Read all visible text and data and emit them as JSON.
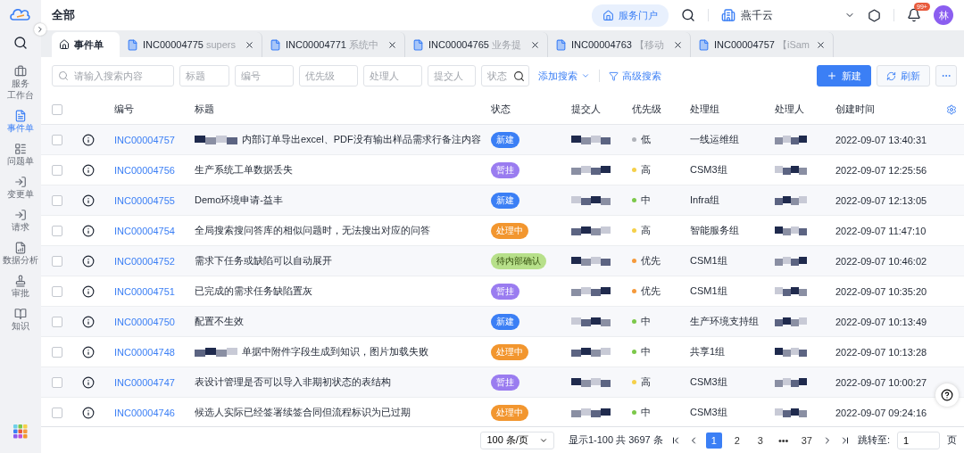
{
  "sidebar": {
    "items": [
      {
        "kind": "workbench",
        "lines": [
          "服务",
          "工作台"
        ],
        "selected": false
      },
      {
        "kind": "incident",
        "lines": [
          "事件单"
        ],
        "selected": true
      },
      {
        "kind": "problem",
        "lines": [
          "问题单"
        ],
        "selected": false
      },
      {
        "kind": "change",
        "lines": [
          "变更单"
        ],
        "selected": false
      },
      {
        "kind": "request",
        "lines": [
          "请求"
        ],
        "selected": false
      },
      {
        "kind": "analytics",
        "lines": [
          "数据分析"
        ],
        "selected": false
      },
      {
        "kind": "approval",
        "lines": [
          "审批"
        ],
        "selected": false
      },
      {
        "kind": "knowledge",
        "lines": [
          "知识"
        ],
        "selected": false
      }
    ]
  },
  "header": {
    "title": "全部",
    "portal": "服务门户",
    "org": "燕千云",
    "notifications": "99+",
    "avatar": "林"
  },
  "tabs": [
    {
      "kind": "home",
      "label": "事件单",
      "selected": true
    },
    {
      "kind": "ticket",
      "label": "INC00004775",
      "detail": "supers",
      "selected": false
    },
    {
      "kind": "ticket",
      "label": "INC00004771",
      "detail": "系统中",
      "selected": false
    },
    {
      "kind": "ticket",
      "label": "INC00004765",
      "detail": "业务提",
      "selected": false
    },
    {
      "kind": "ticket",
      "label": "INC00004763",
      "detail": "【移动",
      "selected": false
    },
    {
      "kind": "ticket",
      "label": "INC00004757",
      "detail": "【iSam",
      "selected": false
    }
  ],
  "filters": {
    "search": {
      "placeholder": "请输入搜索内容"
    },
    "fields": [
      {
        "placeholder": "标题"
      },
      {
        "placeholder": "编号"
      },
      {
        "placeholder": "优先级"
      },
      {
        "placeholder": "处理人"
      },
      {
        "placeholder": "提交人"
      },
      {
        "placeholder": "状态"
      }
    ],
    "add_search": "添加搜索",
    "advanced_search": "高级搜索",
    "new_button": "新建",
    "refresh_button": "刷新"
  },
  "table": {
    "select_all_checked": false,
    "columns": [
      "编号",
      "标题",
      "状态",
      "提交人",
      "优先级",
      "处理组",
      "处理人",
      "创建时间"
    ],
    "rows": [
      {
        "checked": false,
        "id": "INC00004757",
        "redacted": true,
        "title": "内部订单导出excel、PDF没有输出样品需求行备注内容",
        "status": {
          "label": "新建",
          "color": "#3b7ff5"
        },
        "priority": {
          "label": "低",
          "color": "#b0b3ba"
        },
        "group": "一线运维组",
        "created": "2022-09-07 13:40:31"
      },
      {
        "checked": false,
        "id": "INC00004756",
        "redacted": false,
        "title": "生产系统工单数据丢失",
        "status": {
          "label": "暂挂",
          "color": "#9a7cf0"
        },
        "priority": {
          "label": "高",
          "color": "#f5d04a"
        },
        "group": "CSM3组",
        "created": "2022-09-07 12:25:56"
      },
      {
        "checked": false,
        "id": "INC00004755",
        "redacted": false,
        "title": "Demo环境申请-益丰",
        "status": {
          "label": "新建",
          "color": "#3b7ff5"
        },
        "priority": {
          "label": "中",
          "color": "#7cc84a"
        },
        "group": "Infra组",
        "created": "2022-09-07 12:13:05"
      },
      {
        "checked": false,
        "id": "INC00004754",
        "redacted": false,
        "title": "全局搜索搜问答库的相似问题时，无法搜出对应的问答",
        "status": {
          "label": "处理中",
          "color": "#f2962f"
        },
        "priority": {
          "label": "高",
          "color": "#f5d04a"
        },
        "group": "智能服务组",
        "created": "2022-09-07 11:47:10"
      },
      {
        "checked": false,
        "id": "INC00004752",
        "redacted": false,
        "title": "需求下任务或缺陷可以自动展开",
        "status": {
          "label": "待内部确认",
          "color": "#b7e08a"
        },
        "priority": {
          "label": "优先",
          "color": "#f59a3c"
        },
        "group": "CSM1组",
        "created": "2022-09-07 10:46:02"
      },
      {
        "checked": false,
        "id": "INC00004751",
        "redacted": false,
        "title": "已完成的需求任务缺陷置灰",
        "status": {
          "label": "暂挂",
          "color": "#9a7cf0"
        },
        "priority": {
          "label": "优先",
          "color": "#f59a3c"
        },
        "group": "CSM1组",
        "created": "2022-09-07 10:35:20"
      },
      {
        "checked": false,
        "id": "INC00004750",
        "redacted": false,
        "title": "配置不生效",
        "status": {
          "label": "新建",
          "color": "#3b7ff5"
        },
        "priority": {
          "label": "中",
          "color": "#7cc84a"
        },
        "group": "生产环境支持组",
        "created": "2022-09-07 10:13:49"
      },
      {
        "checked": false,
        "id": "INC00004748",
        "redacted": true,
        "title": "单据中附件字段生成到知识，图片加载失败",
        "status": {
          "label": "处理中",
          "color": "#f2962f"
        },
        "priority": {
          "label": "中",
          "color": "#7cc84a"
        },
        "group": "共享1组",
        "created": "2022-09-07 10:13:28"
      },
      {
        "checked": false,
        "id": "INC00004747",
        "redacted": false,
        "title": "表设计管理是否可以导入非期初状态的表结构",
        "status": {
          "label": "暂挂",
          "color": "#9a7cf0"
        },
        "priority": {
          "label": "高",
          "color": "#f5d04a"
        },
        "group": "CSM3组",
        "created": "2022-09-07 10:00:27"
      },
      {
        "checked": false,
        "id": "INC00004746",
        "redacted": false,
        "title": "候选人实际已经签署续签合同但流程标识为已过期",
        "status": {
          "label": "处理中",
          "color": "#f2962f"
        },
        "priority": {
          "label": "中",
          "color": "#7cc84a"
        },
        "group": "CSM3组",
        "created": "2022-09-07 09:24:16"
      }
    ]
  },
  "pagination": {
    "page_size": "100 条/页",
    "summary": "显示1-100 共 3697 条",
    "pages": [
      {
        "label": "1",
        "selected": true
      },
      {
        "label": "2",
        "selected": false
      },
      {
        "label": "3",
        "selected": false
      },
      {
        "label": "•••",
        "selected": false
      },
      {
        "label": "37",
        "selected": false
      }
    ],
    "jump_label": "跳转至:",
    "jump_value": "1",
    "jump_unit": "页"
  }
}
